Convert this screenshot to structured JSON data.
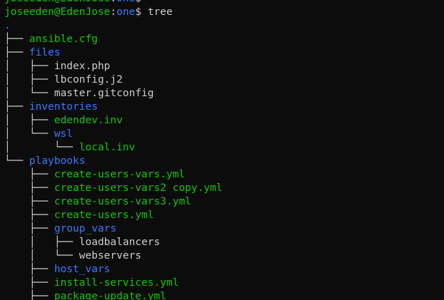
{
  "prompt": {
    "user_host": "joseeden@EdenJose",
    "separator": ":",
    "cwd": "one",
    "symbol": "$"
  },
  "command": "tree",
  "tree": [
    {
      "prefix": "",
      "name": ".",
      "kind": "dir"
    },
    {
      "prefix": "├── ",
      "name": "ansible.cfg",
      "kind": "file-green"
    },
    {
      "prefix": "├── ",
      "name": "files",
      "kind": "dir"
    },
    {
      "prefix": "│   ├── ",
      "name": "index.php",
      "kind": "file"
    },
    {
      "prefix": "│   ├── ",
      "name": "lbconfig.j2",
      "kind": "file"
    },
    {
      "prefix": "│   └── ",
      "name": "master.gitconfig",
      "kind": "file"
    },
    {
      "prefix": "├── ",
      "name": "inventories",
      "kind": "dir"
    },
    {
      "prefix": "│   ├── ",
      "name": "edendev.inv",
      "kind": "file-green"
    },
    {
      "prefix": "│   └── ",
      "name": "wsl",
      "kind": "dir"
    },
    {
      "prefix": "│       └── ",
      "name": "local.inv",
      "kind": "file-green"
    },
    {
      "prefix": "└── ",
      "name": "playbooks",
      "kind": "dir"
    },
    {
      "prefix": "    ├── ",
      "name": "create-users-vars.yml",
      "kind": "file-green"
    },
    {
      "prefix": "    ├── ",
      "name": "create-users-vars2 copy.yml",
      "kind": "file-green"
    },
    {
      "prefix": "    ├── ",
      "name": "create-users-vars3.yml",
      "kind": "file-green"
    },
    {
      "prefix": "    ├── ",
      "name": "create-users.yml",
      "kind": "file-green"
    },
    {
      "prefix": "    ├── ",
      "name": "group_vars",
      "kind": "dir"
    },
    {
      "prefix": "    │   ├── ",
      "name": "loadbalancers",
      "kind": "file"
    },
    {
      "prefix": "    │   └── ",
      "name": "webservers",
      "kind": "file"
    },
    {
      "prefix": "    ├── ",
      "name": "host_vars",
      "kind": "dir"
    },
    {
      "prefix": "    ├── ",
      "name": "install-services.yml",
      "kind": "file-green"
    },
    {
      "prefix": "    ├── ",
      "name": "package-update.yml",
      "kind": "file-green"
    }
  ],
  "colors": {
    "background": "#0c0c0c",
    "text": "#cccccc",
    "green": "#16c60c",
    "blue": "#3b78ff"
  }
}
